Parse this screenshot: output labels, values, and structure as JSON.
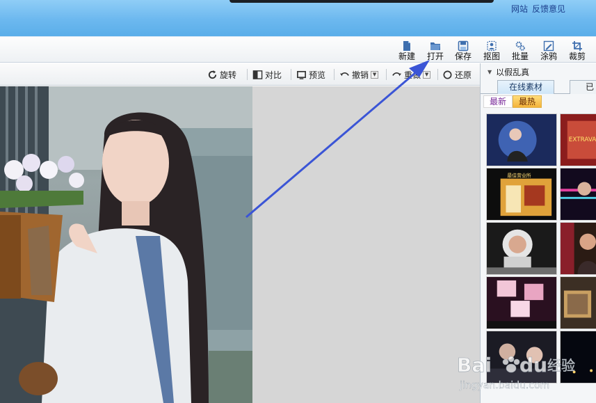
{
  "top_links": {
    "website": "网站",
    "feedback": "反馈意见"
  },
  "toolbar": {
    "new": "新建",
    "open": "打开",
    "save": "保存",
    "cutout": "抠图",
    "batch": "批量",
    "doodle": "涂鸦",
    "crop": "裁剪"
  },
  "subbar": {
    "rotate": "旋转",
    "compare": "对比",
    "preview": "预览",
    "undo": "撤销",
    "redo": "重做",
    "restore": "还原"
  },
  "panel": {
    "title": "以假乱真",
    "tab_online": "在线素材",
    "tab_other": "已",
    "subtab_new": "最新",
    "subtab_hot": "最热",
    "thumbs": [
      {
        "text": ""
      },
      {
        "text": "EXTRAVAGANZA"
      },
      {
        "text": "最佳营业所"
      },
      {
        "text": ""
      },
      {
        "text": ""
      },
      {
        "text": ""
      },
      {
        "text": ""
      },
      {
        "text": ""
      },
      {
        "text": ""
      },
      {
        "text": ""
      }
    ]
  },
  "watermark": {
    "brand": "Bai",
    "brand2": "du",
    "jingyan": "经验",
    "url": "jingyan.baidu.com"
  },
  "colors": {
    "titlebar": "#6cb8ef",
    "link": "#1c3f8c",
    "arrow": "#3b55d6",
    "hot_tab": "#f3b23a",
    "canvas": "#d6d6d6"
  },
  "icons": {
    "new": "new-file-icon",
    "open": "folder-icon",
    "save": "floppy-icon",
    "cutout": "cutout-icon",
    "batch": "gears-icon",
    "doodle": "brush-icon",
    "crop": "crop-icon"
  }
}
